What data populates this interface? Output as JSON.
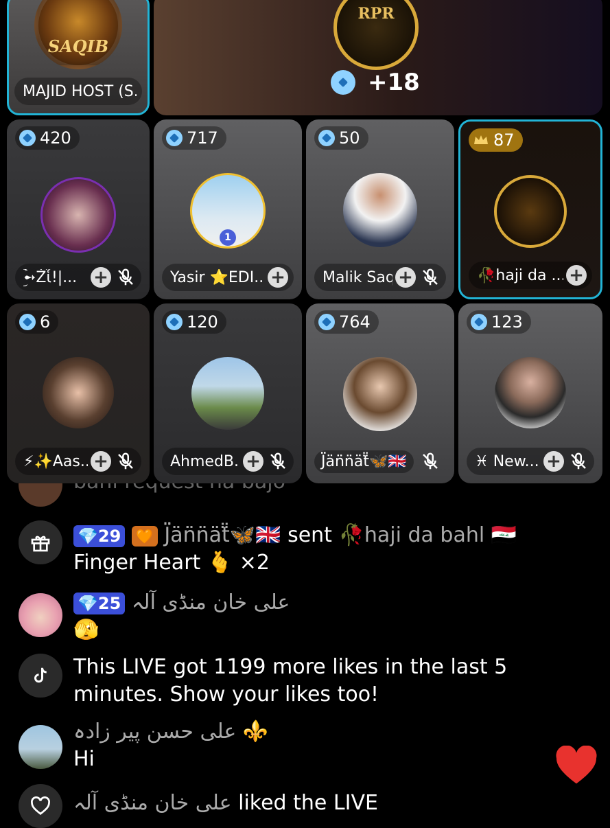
{
  "host": {
    "name": "MAJID HOST (S...",
    "avatar_text": "SAQIB"
  },
  "top_banner": {
    "count": "+18",
    "logo_text": "RPR"
  },
  "guests": [
    {
      "count": "420",
      "name": "ؘ͜͡➻Żἷ!|...",
      "badge": "gem"
    },
    {
      "count": "717",
      "name": "Yasir ⭐EDI...",
      "badge": "gem"
    },
    {
      "count": "50",
      "name": "Malik Saq...",
      "badge": "gem"
    },
    {
      "count": "87",
      "name": "🥀haji da ...",
      "badge": "crown"
    },
    {
      "count": "6",
      "name": "⚡✨Aas...",
      "badge": "gem"
    },
    {
      "count": "120",
      "name": "AhmedB...",
      "badge": "gem"
    },
    {
      "count": "764",
      "name": "J̈̈än̈̈n̈äẗ̈🦋🇬🇧",
      "badge": "gem"
    },
    {
      "count": "123",
      "name": "♓ New...",
      "badge": "gem"
    }
  ],
  "chat": {
    "partial": "bahl request na bajo",
    "msg1": {
      "level": "29",
      "user": "J̈̈än̈̈n̈äẗ̈🦋🇬🇧",
      "sent": "sent",
      "target": "🥀haji da bahl 🇮🇶",
      "gift": "Finger Heart 🫰 ×2"
    },
    "msg2": {
      "level": "25",
      "user": "علی خان منڈی آلہ",
      "text": "🫣"
    },
    "msg3": {
      "text": "This LIVE got 1199 more likes in the last 5 minutes. Show your likes too!"
    },
    "msg4": {
      "user": "علی حسن پیر زادہ ⚜️",
      "text": "Hi"
    },
    "msg5": {
      "user": "علی خان منڈی آلہ",
      "text": "liked the LIVE"
    }
  },
  "colors": {
    "highlight": "#22b4d6",
    "level_pill": "#3b4fd9",
    "heart": "#e8322e"
  }
}
